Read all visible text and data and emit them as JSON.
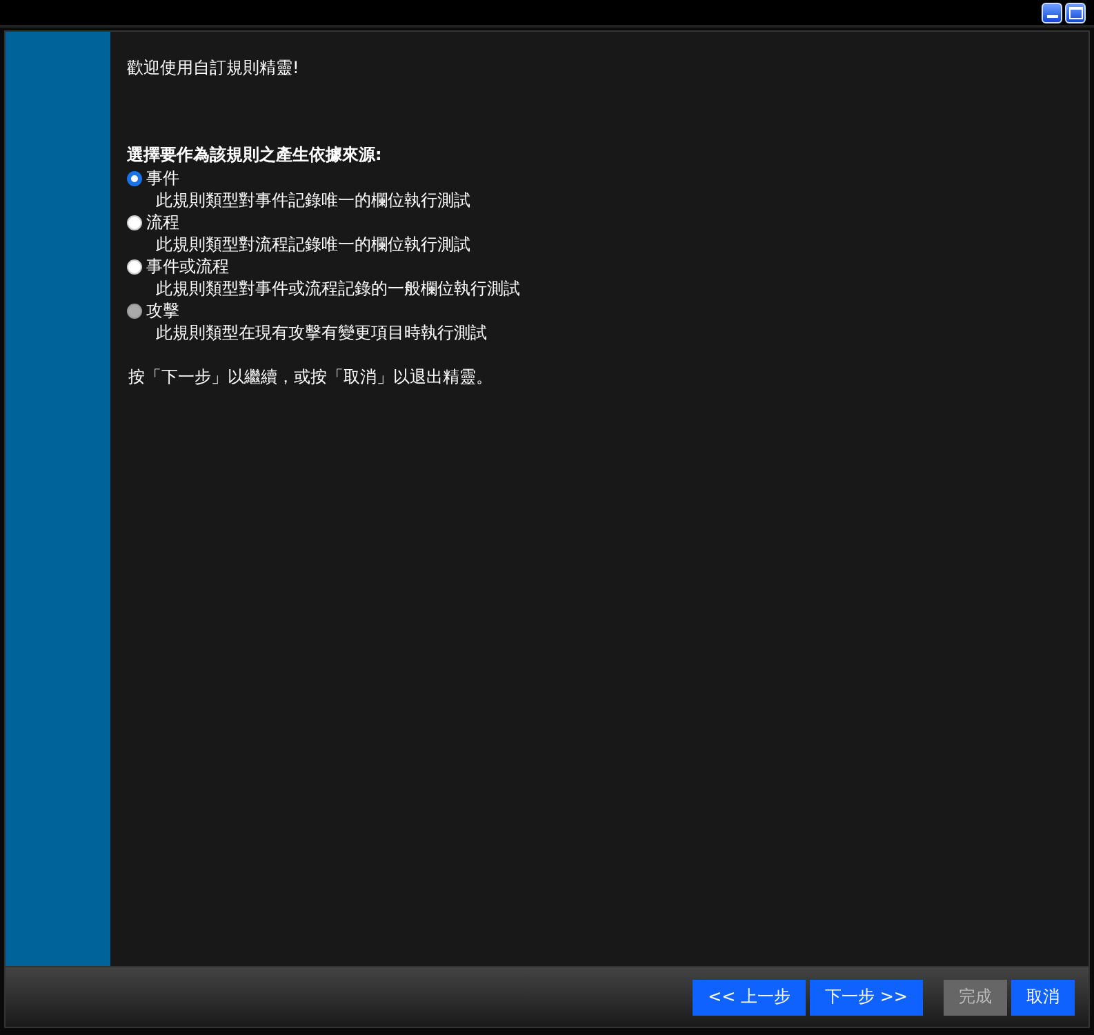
{
  "title_bar": {
    "buttons": [
      {
        "kind": "minimize"
      },
      {
        "kind": "maximize"
      }
    ]
  },
  "welcome": "歡迎使用自訂規則精靈!",
  "prompt": "選擇要作為該規則之產生依據來源:",
  "options": [
    {
      "label": "事件",
      "description": "此規則類型對事件記錄唯一的欄位執行測試",
      "selected": true,
      "disabled": false
    },
    {
      "label": "流程",
      "description": "此規則類型對流程記錄唯一的欄位執行測試",
      "selected": false,
      "disabled": false
    },
    {
      "label": "事件或流程",
      "description": "此規則類型對事件或流程記錄的一般欄位執行測試",
      "selected": false,
      "disabled": false
    },
    {
      "label": "攻擊",
      "description": "此規則類型在現有攻擊有變更項目時執行測試",
      "selected": false,
      "disabled": true
    }
  ],
  "instruction": "按「下一步」以繼續，或按「取消」以退出精靈。",
  "buttons": [
    {
      "label": "<< 上一步",
      "disabled": false
    },
    {
      "label": "下一步 >>",
      "disabled": false
    },
    {
      "label": "完成",
      "disabled": true
    },
    {
      "label": "取消",
      "disabled": false
    }
  ]
}
